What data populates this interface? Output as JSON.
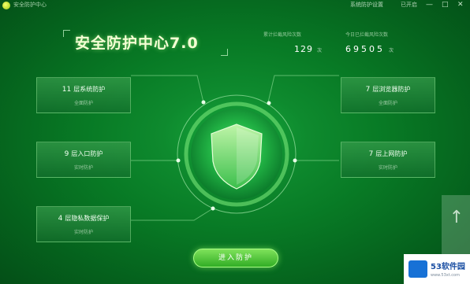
{
  "window": {
    "title": "安全防护中心",
    "toolbar": [
      "系统防护设置",
      "已开启"
    ],
    "controls": {
      "minimize": "—",
      "maximize": "□",
      "close": "✕"
    }
  },
  "headline": "安全防护中心7.0",
  "stats": [
    {
      "label": "累计拦截风险次数",
      "value": "129",
      "unit": "次"
    },
    {
      "label": "今日已拦截风险次数",
      "value": "69505",
      "unit": "次"
    }
  ],
  "cards": [
    {
      "num": "11",
      "title": "层系统防护",
      "sub": "全面防护"
    },
    {
      "num": "9",
      "title": "层入口防护",
      "sub": "实时防护"
    },
    {
      "num": "4",
      "title": "层隐私数据保护",
      "sub": "实时防护"
    },
    {
      "num": "7",
      "title": "层浏览器防护",
      "sub": "全面防护"
    },
    {
      "num": "7",
      "title": "层上网防护",
      "sub": "实时防护"
    }
  ],
  "enter_button": "进入防护",
  "scroll_top_icon": "arrow-up-icon",
  "site_badge": {
    "name": "53软件园",
    "url": "www.53xt.com"
  },
  "colors": {
    "background": "#087a25",
    "accent": "#7fe25b",
    "headline": "#f4ffd4"
  }
}
